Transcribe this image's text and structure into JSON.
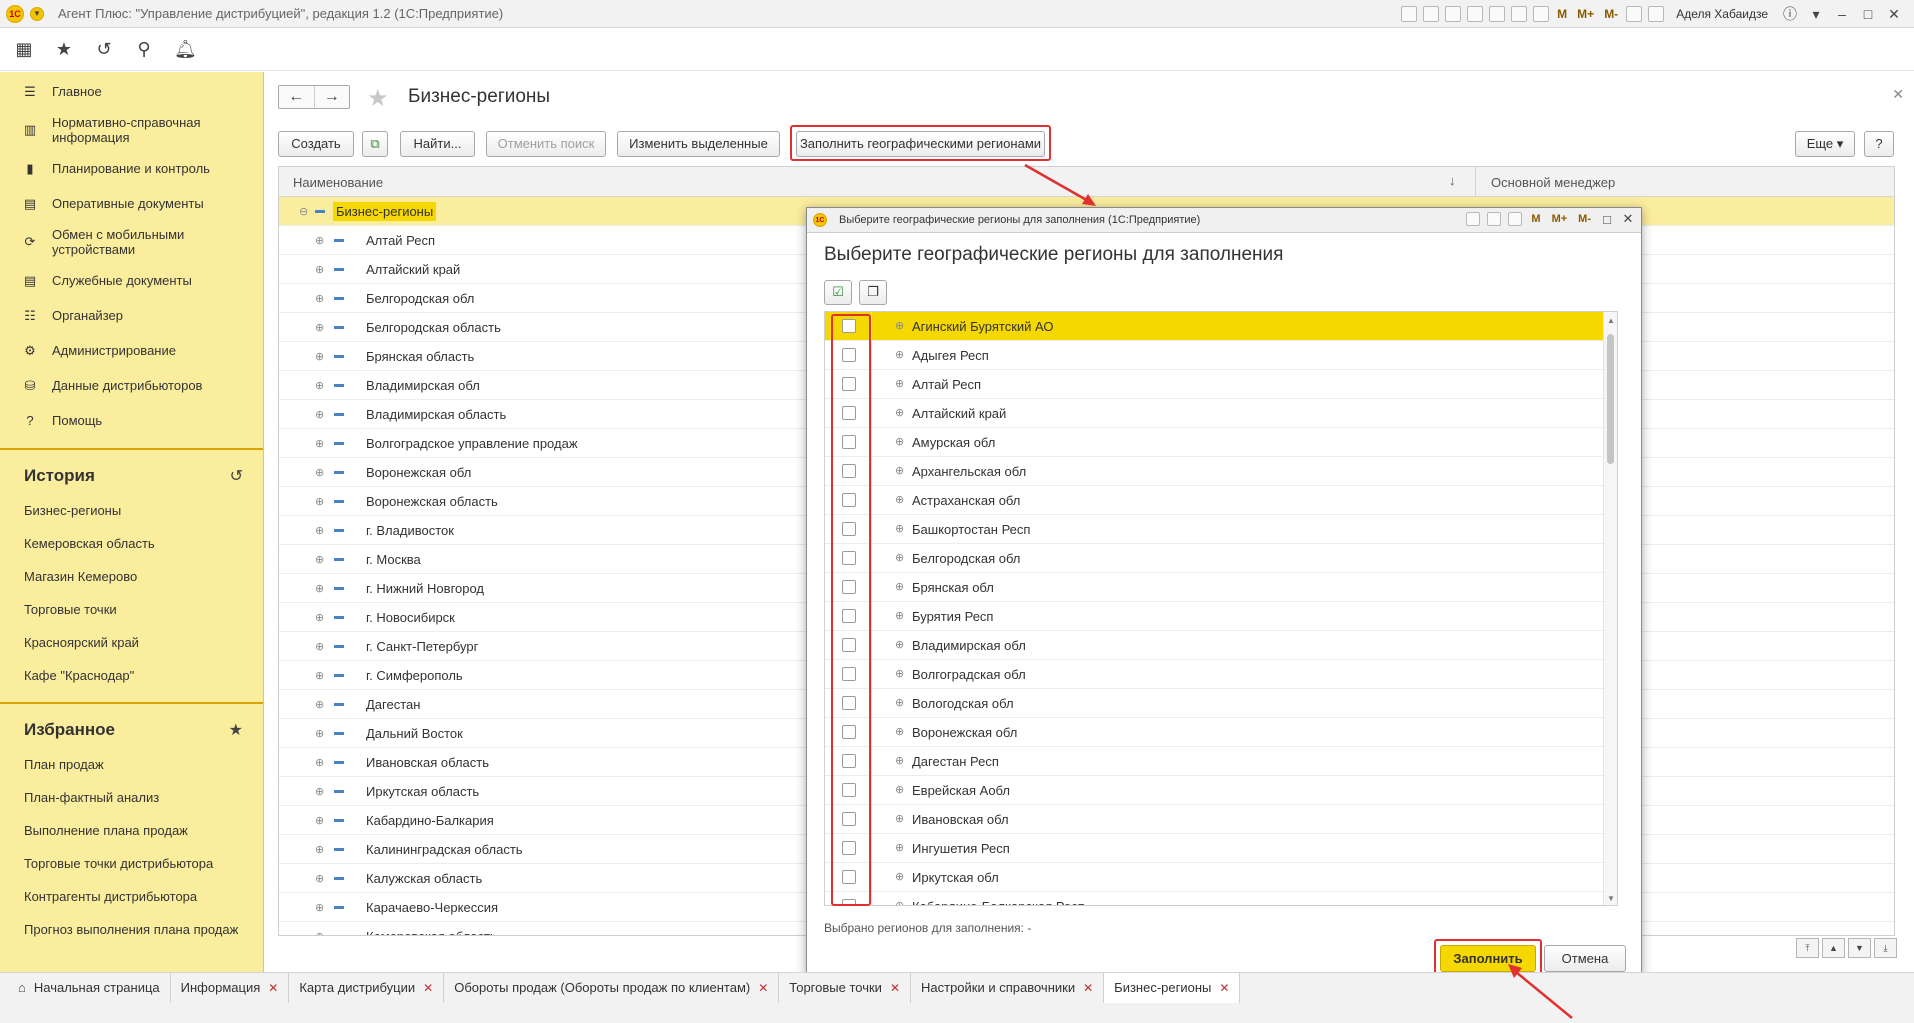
{
  "app": {
    "logo_text": "1С",
    "title": "Агент Плюс: \"Управление дистрибуцией\", редакция 1.2  (1С:Предприятие)",
    "user": "Аделя Хабаидзе",
    "m_labels": [
      "M",
      "M+",
      "M-"
    ]
  },
  "sidebar": {
    "items": [
      {
        "label": "Главное",
        "icon": "menu-icon"
      },
      {
        "label": "Нормативно-справочная информация",
        "icon": "grid-icon"
      },
      {
        "label": "Планирование и контроль",
        "icon": "chart-icon"
      },
      {
        "label": "Оперативные документы",
        "icon": "document-icon"
      },
      {
        "label": "Обмен с мобильными устройствами",
        "icon": "sync-icon"
      },
      {
        "label": "Служебные документы",
        "icon": "document-icon"
      },
      {
        "label": "Органайзер",
        "icon": "organizer-icon"
      },
      {
        "label": "Администрирование",
        "icon": "gear-icon"
      },
      {
        "label": "Данные дистрибьюторов",
        "icon": "database-icon"
      },
      {
        "label": "Помощь",
        "icon": "help-icon"
      }
    ],
    "history_title": "История",
    "history": [
      "Бизнес-регионы",
      "Кемеровская область",
      "Магазин Кемерово",
      "Торговые точки",
      "Красноярский край",
      "Кафе \"Краснодар\""
    ],
    "favorites_title": "Избранное",
    "favorites": [
      "План продаж",
      "План-фактный анализ",
      "Выполнение плана продаж",
      "Торговые точки дистрибьютора",
      "Контрагенты дистрибьютора",
      "Прогноз выполнения плана продаж"
    ]
  },
  "main": {
    "title": "Бизнес-регионы",
    "toolbar": {
      "create": "Создать",
      "find": "Найти...",
      "cancel_search": "Отменить поиск",
      "edit_selected": "Изменить выделенные",
      "fill_geo": "Заполнить географическими регионами",
      "more": "Еще",
      "help": "?"
    },
    "table": {
      "col_name": "Наименование",
      "col_manager": "Основной менеджер",
      "root": "Бизнес-регионы",
      "rows": [
        "Алтай Респ",
        "Алтайский край",
        "Белгородская обл",
        "Белгородская область",
        "Брянская область",
        "Владимирская обл",
        "Владимирская область",
        "Волгоградское управление продаж",
        "Воронежская обл",
        "Воронежская область",
        "г. Владивосток",
        "г. Москва",
        "г. Нижний Новгород",
        "г. Новосибирск",
        "г. Санкт-Петербург",
        "г. Симферополь",
        "Дагестан",
        "Дальний Восток",
        "Ивановская область",
        "Иркутская область",
        "Кабардино-Балкария",
        "Калининградская область",
        "Калужская область",
        "Карачаево-Черкессия",
        "Кемеровская область"
      ]
    }
  },
  "dialog": {
    "window_title": "Выберите географические регионы для заполнения  (1С:Предприятие)",
    "heading": "Выберите географические регионы для заполнения",
    "items": [
      "Агинский Бурятский АО",
      "Адыгея Респ",
      "Алтай Респ",
      "Алтайский край",
      "Амурская обл",
      "Архангельская обл",
      "Астраханская обл",
      "Башкортостан Респ",
      "Белгородская обл",
      "Брянская обл",
      "Бурятия Респ",
      "Владимирская обл",
      "Волгоградская обл",
      "Вологодская обл",
      "Воронежская обл",
      "Дагестан Респ",
      "Еврейская Аобл",
      "Ивановская обл",
      "Ингушетия Респ",
      "Иркутская обл",
      "Кабардино-Балкарская Респ"
    ],
    "status": "Выбрано регионов для заполнения:  -",
    "fill_button": "Заполнить",
    "cancel_button": "Отмена"
  },
  "tabs": [
    "Начальная страница",
    "Информация",
    "Карта дистрибуции",
    "Обороты продаж (Обороты продаж по клиентам)",
    "Торговые точки",
    "Настройки и справочники",
    "Бизнес-регионы"
  ],
  "colors": {
    "accent": "#f5d800",
    "sidebar": "#fbed9e",
    "highlight_box": "#e03030"
  }
}
